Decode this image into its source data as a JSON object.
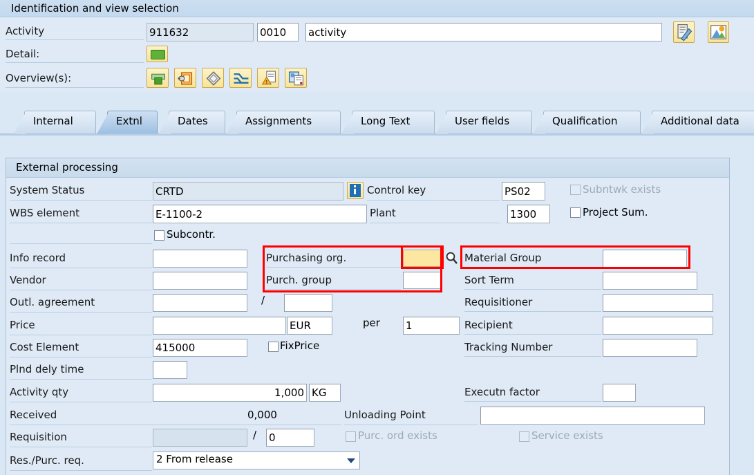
{
  "identification": {
    "title": "Identification and view selection",
    "activity": {
      "label": "Activity",
      "number": "911632",
      "operation": "0010",
      "description": "activity"
    },
    "detail": {
      "label": "Detail:"
    },
    "overviews": {
      "label": "Overview(s):"
    },
    "icons": {
      "edit": "edit-document-icon",
      "picture": "picture-landscape-icon",
      "detail_green": "detail-green-bar-icon",
      "ov1": "overview-printer-icon",
      "ov2": "overview-component-icon",
      "ov3": "overview-diamond-icon",
      "ov4": "overview-relationship-icon",
      "ov5": "overview-capacity-icon",
      "ov6": "overview-documents-icon"
    }
  },
  "tabs": [
    {
      "label": "Internal",
      "selected": false
    },
    {
      "label": "Extnl",
      "selected": true
    },
    {
      "label": "Dates",
      "selected": false
    },
    {
      "label": "Assignments",
      "selected": false
    },
    {
      "label": "Long Text",
      "selected": false
    },
    {
      "label": "User fields",
      "selected": false
    },
    {
      "label": "Qualification",
      "selected": false
    },
    {
      "label": "Additional data",
      "selected": false
    }
  ],
  "external_processing": {
    "group_title": "External processing",
    "left": {
      "system_status": {
        "label": "System Status",
        "value": "CRTD",
        "readonly": true
      },
      "wbs_element": {
        "label": "WBS element",
        "value": "E-1100-2"
      },
      "subcontr": {
        "label": "Subcontr.",
        "checked": false
      },
      "info_record": {
        "label": "Info record",
        "value": ""
      },
      "vendor": {
        "label": "Vendor",
        "value": ""
      },
      "outl_agreement": {
        "label": "Outl. agreement",
        "value": "",
        "separator": "/",
        "value2": ""
      },
      "price": {
        "label": "Price",
        "value": "",
        "currency": "EUR"
      },
      "per": {
        "label": "per",
        "value": "1"
      },
      "cost_element": {
        "label": "Cost Element",
        "value": "415000"
      },
      "fixprice": {
        "label": "FixPrice",
        "checked": false
      },
      "plnd_dely_time": {
        "label": "Plnd dely time",
        "value": ""
      },
      "activity_qty": {
        "label": "Activity qty",
        "value": "1,000",
        "unit": "KG"
      },
      "received": {
        "label": "Received",
        "value": "0,000"
      },
      "requisition": {
        "label": "Requisition",
        "value": "",
        "separator": "/",
        "value2": "0"
      },
      "res_purc_req": {
        "label": "Res./Purc. req.",
        "value": "2 From release"
      }
    },
    "middle": {
      "control_key": {
        "label": "Control key",
        "value": "PS02"
      },
      "plant": {
        "label": "Plant",
        "value": "1300"
      },
      "purchasing_org": {
        "label": "Purchasing org.",
        "value": "",
        "highlighted": true
      },
      "purch_group": {
        "label": "Purch. group",
        "value": ""
      },
      "info_icon": "info-icon",
      "search_icon": "search-magnifier-icon"
    },
    "right": {
      "subntwk_exists": {
        "label": "Subntwk exists",
        "checked": false,
        "disabled": true
      },
      "project_sum": {
        "label": "Project Sum.",
        "checked": false
      },
      "material_group": {
        "label": "Material Group",
        "value": ""
      },
      "sort_term": {
        "label": "Sort Term",
        "value": ""
      },
      "requisitioner": {
        "label": "Requisitioner",
        "value": ""
      },
      "recipient": {
        "label": "Recipient",
        "value": ""
      },
      "tracking_number": {
        "label": "Tracking Number",
        "value": ""
      },
      "executn_factor": {
        "label": "Executn factor",
        "value": ""
      },
      "unloading_point": {
        "label": "Unloading Point",
        "value": ""
      },
      "purc_ord_exists": {
        "label": "Purc. ord exists",
        "checked": false,
        "disabled": true
      },
      "service_exists": {
        "label": "Service exists",
        "checked": false,
        "disabled": true
      }
    }
  },
  "annotations": {
    "highlight_color": "#fe0000",
    "boxes": [
      {
        "name": "purchasing-org-group-highlight"
      },
      {
        "name": "purchasing-org-field-highlight"
      },
      {
        "name": "material-group-highlight"
      }
    ]
  }
}
